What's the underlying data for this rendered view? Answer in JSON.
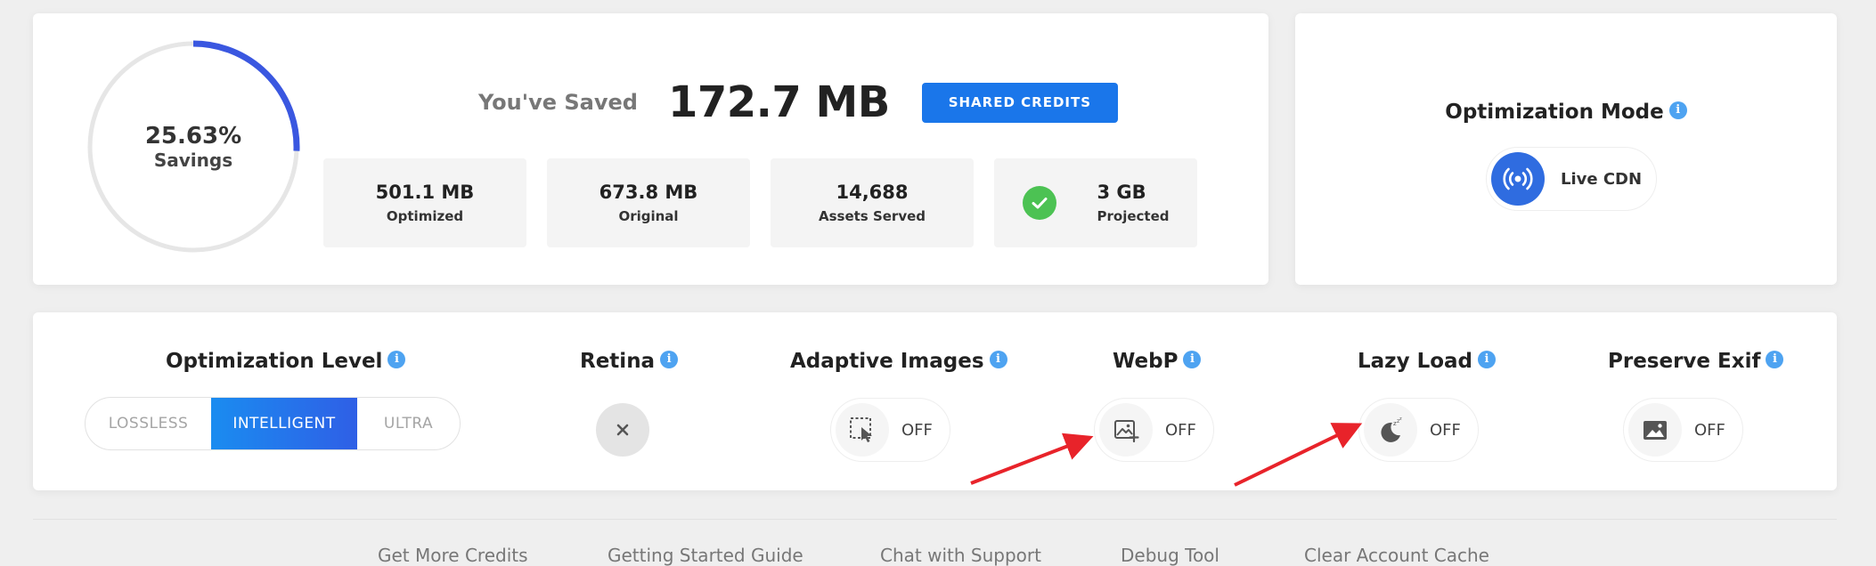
{
  "savings": {
    "percent": "25.63%",
    "label": "Savings",
    "fraction": 0.2563
  },
  "saved": {
    "label": "You've Saved",
    "value": "172.7 MB",
    "button_label": "SHARED CREDITS"
  },
  "stats": [
    {
      "value": "501.1 MB",
      "label": "Optimized"
    },
    {
      "value": "673.8 MB",
      "label": "Original"
    },
    {
      "value": "14,688",
      "label": "Assets Served"
    },
    {
      "value": "3 GB",
      "label": "Projected"
    }
  ],
  "mode": {
    "title": "Optimization Mode",
    "info": "i",
    "value": "Live CDN"
  },
  "settings": {
    "level": {
      "title": "Optimization Level",
      "options": [
        "LOSSLESS",
        "INTELLIGENT",
        "ULTRA"
      ],
      "selected": "INTELLIGENT"
    },
    "retina": {
      "title": "Retina"
    },
    "adaptive": {
      "title": "Adaptive Images",
      "state": "OFF"
    },
    "webp": {
      "title": "WebP",
      "state": "OFF"
    },
    "lazy": {
      "title": "Lazy Load",
      "state": "OFF"
    },
    "exif": {
      "title": "Preserve Exif",
      "state": "OFF"
    },
    "info": "i"
  },
  "footer": {
    "links": [
      "Get More Credits",
      "Getting Started Guide",
      "Chat with Support",
      "Debug Tool",
      "Clear Account Cache"
    ]
  },
  "colors": {
    "accent": "#1a76ea",
    "ring_progress": "#3a57e0",
    "ring_track": "#e6e6e6",
    "success": "#4cc253",
    "info": "#4ea3f1",
    "arrow": "#e8232a"
  }
}
